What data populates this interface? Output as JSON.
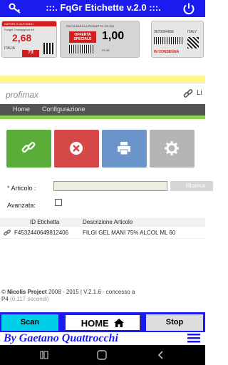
{
  "app": {
    "title": ":::.  FqGr Etichette v.2.0  :::.",
    "banner_card1_line1": "SAPORI DI AUTUNNO",
    "banner_card1_line2": "Funghi Champignon trif.",
    "banner_card1_price": "2,68",
    "banner_card1_country": "ITALIA",
    "banner_card1_tag": "73",
    "banner_card2_line1": "PASTA BARILLA PENNETTE GR.500",
    "banner_card2_offer": "OFFERTA SPECIALE",
    "banner_card2_price": "1,00",
    "banner_card2_code": "P2.36",
    "banner_card3_code": "3670004666",
    "banner_card3_country": "ITALY",
    "banner_card3_status": "IN CONSEGNA"
  },
  "header": {
    "logo": "profimax",
    "menu": [
      "Home",
      "Configurazione"
    ],
    "cut_label": "Li"
  },
  "tiles": [
    {
      "name": "link",
      "color": "#5bad3a"
    },
    {
      "name": "cancel",
      "color": "#d64747"
    },
    {
      "name": "print",
      "color": "#6b94cb"
    },
    {
      "name": "settings",
      "color": "#b5b5b5"
    }
  ],
  "form": {
    "articolo_label": "Articolo :",
    "articolo_required": "*",
    "articolo_value": "",
    "cerca_label": "Ricerca",
    "avanzate_label": "Avanzata:",
    "avanzate_checked": false
  },
  "table": {
    "headers": [
      "ID Etichetta",
      "Descrizione Articolo"
    ],
    "rows": [
      {
        "id": "F4532440649812406",
        "descrizione": "FILGI GEL MANI 75% ALCOL ML 60"
      }
    ]
  },
  "footer": {
    "copyright_symbol": "©",
    "company": "Nicolis Project",
    "years_version": " 2008 - 2015 | V.2.1.6 - concesso a",
    "licensee": "P4",
    "timing": " (0,117 secondi)"
  },
  "bottom": {
    "scan_label": "Scan",
    "home_label": "HOME",
    "stop_label": "Stop",
    "signature": "By Gaetano Quattrocchi"
  }
}
